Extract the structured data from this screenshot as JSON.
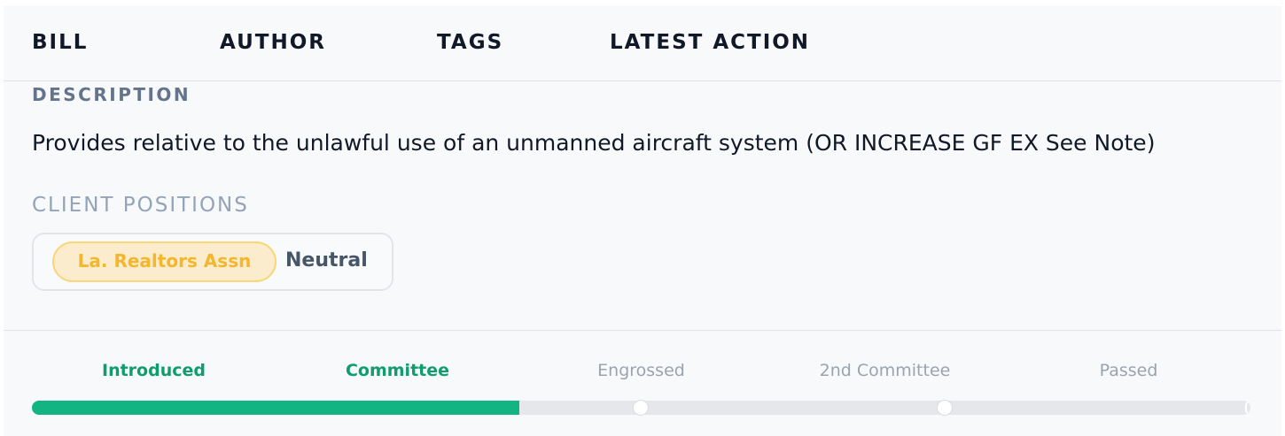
{
  "table_header": {
    "bill": "BILL",
    "author": "AUTHOR",
    "tags": "TAGS",
    "latest_action": "LATEST ACTION"
  },
  "description": {
    "label": "DESCRIPTION",
    "text": "Provides relative to the unlawful use of an unmanned aircraft system (OR INCREASE GF EX See Note)"
  },
  "client_positions": {
    "label": "CLIENT POSITIONS",
    "items": [
      {
        "client": "La. Realtors Assn",
        "position": "Neutral"
      }
    ]
  },
  "progress": {
    "stages": [
      {
        "label": "Introduced",
        "status": "complete"
      },
      {
        "label": "Committee",
        "status": "complete"
      },
      {
        "label": "Engrossed",
        "status": "pending"
      },
      {
        "label": "2nd Committee",
        "status": "pending"
      },
      {
        "label": "Passed",
        "status": "pending"
      }
    ],
    "completed_fraction": 0.4
  },
  "colors": {
    "complete": "#12b582",
    "complete_text": "#0f9d6b",
    "pending_text": "#9ca3af",
    "client_pill_bg": "#fbeccd",
    "client_pill_text": "#f4b62c"
  }
}
